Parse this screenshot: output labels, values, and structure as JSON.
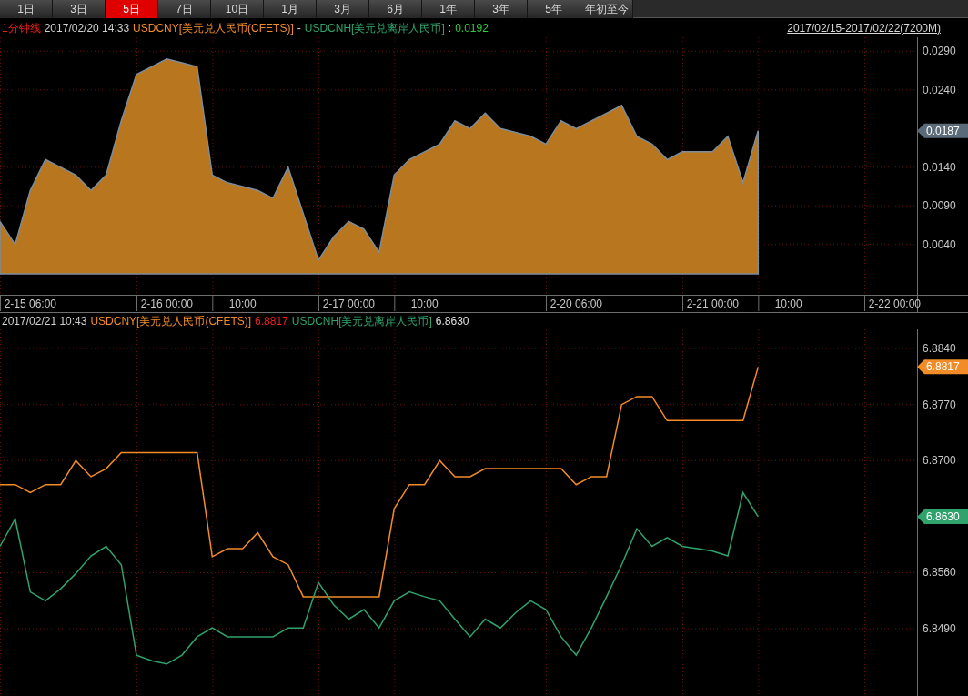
{
  "tabs": [
    {
      "label": "1日",
      "selected": false
    },
    {
      "label": "3日",
      "selected": false
    },
    {
      "label": "5日",
      "selected": true
    },
    {
      "label": "7日",
      "selected": false
    },
    {
      "label": "10日",
      "selected": false
    },
    {
      "label": "1月",
      "selected": false
    },
    {
      "label": "3月",
      "selected": false
    },
    {
      "label": "6月",
      "selected": false
    },
    {
      "label": "1年",
      "selected": false
    },
    {
      "label": "3年",
      "selected": false
    },
    {
      "label": "5年",
      "selected": false
    },
    {
      "label": "年初至今",
      "selected": false
    }
  ],
  "spread_panel": {
    "period": "1分钟线",
    "time": "2017/02/20 14:33",
    "series_a": "USDCNY[美元兑人民币(CFETS)]",
    "separator": "-",
    "series_b": "USDCNH[美元兑离岸人民币]",
    "colon": ":",
    "value": "0.0192",
    "range_link": "2017/02/15-2017/02/22(7200M)",
    "chart_data": {
      "type": "area",
      "ylim": [
        -0.0025,
        0.0308
      ],
      "grid": true,
      "categories": [
        null,
        null,
        "2-15 06:00",
        null,
        null,
        null,
        null,
        null,
        null,
        null,
        null,
        "2-16 00:00",
        null,
        null,
        null,
        null,
        "10:00",
        null,
        null,
        null,
        null,
        null,
        null,
        "2-17 00:00",
        null,
        null,
        null,
        null,
        "10:00",
        null,
        null,
        null,
        null,
        null,
        null,
        null,
        null,
        null,
        "2-20 06:00",
        null,
        null,
        null,
        null,
        null,
        null,
        null,
        null,
        "2-21 00:00",
        null,
        null,
        null,
        null,
        "10:00",
        null,
        null,
        null,
        null,
        null,
        null,
        "2-22 00:00",
        null
      ],
      "series": [
        {
          "color": "#b8761f",
          "values": [
            0.007,
            0.004,
            0.011,
            0.015,
            0.014,
            0.013,
            0.011,
            0.013,
            0.02,
            0.026,
            0.027,
            0.028,
            0.0275,
            0.027,
            0.013,
            0.012,
            0.0115,
            0.011,
            0.01,
            0.014,
            0.008,
            0.002,
            0.005,
            0.007,
            0.006,
            0.003,
            0.013,
            0.015,
            0.016,
            0.017,
            0.02,
            0.019,
            0.021,
            0.019,
            0.0185,
            0.018,
            0.017,
            0.02,
            0.019,
            0.02,
            0.021,
            0.022,
            0.018,
            0.017,
            0.015,
            0.016,
            0.016,
            0.016,
            0.018,
            0.012,
            0.0187,
            null,
            null,
            null,
            null,
            null,
            null,
            null,
            null,
            null,
            null
          ]
        }
      ],
      "yticks": [
        {
          "value": 0.029,
          "label": "0.0290"
        },
        {
          "value": 0.024,
          "label": "0.0240"
        },
        {
          "value": 0.014,
          "label": "0.0140"
        },
        {
          "value": 0.009,
          "label": "0.0090"
        },
        {
          "value": 0.004,
          "label": "0.0040"
        }
      ],
      "annotations": [
        "0.0187"
      ]
    }
  },
  "price_panel": {
    "time": "2017/02/21 10:43",
    "value_a": "6.8817",
    "value_b": "6.8630",
    "chart_data": {
      "type": "line",
      "grid": true,
      "ylim": [
        6.8406,
        6.8864
      ],
      "series": [
        {
          "name": "USDCNY[美元兑人民币(CFETS)]",
          "color": "#f28c28",
          "values": [
            6.867,
            6.867,
            6.866,
            6.867,
            6.867,
            6.87,
            6.868,
            6.869,
            6.871,
            6.871,
            6.871,
            6.871,
            6.871,
            6.871,
            6.858,
            6.859,
            6.859,
            6.861,
            6.858,
            6.857,
            6.853,
            6.853,
            6.853,
            6.853,
            6.853,
            6.853,
            6.864,
            6.867,
            6.867,
            6.87,
            6.868,
            6.868,
            6.869,
            6.869,
            6.869,
            6.869,
            6.869,
            6.869,
            6.867,
            6.868,
            6.868,
            6.877,
            6.878,
            6.878,
            6.875,
            6.875,
            6.875,
            6.875,
            6.875,
            6.875,
            6.8817
          ]
        },
        {
          "name": "USDCNH[美元兑离岸人民币]",
          "color": "#2fa36b",
          "values": [
            6.8593,
            6.8627,
            6.8536,
            6.8525,
            6.854,
            6.8559,
            6.8581,
            6.8593,
            6.857,
            6.8457,
            6.845,
            6.8446,
            6.8457,
            6.848,
            6.8491,
            6.848,
            6.848,
            6.848,
            6.848,
            6.8491,
            6.8491,
            6.8548,
            6.852,
            6.8502,
            6.8514,
            6.8491,
            6.8525,
            6.8536,
            6.853,
            6.8525,
            6.8502,
            6.848,
            6.8502,
            6.8491,
            6.851,
            6.8525,
            6.8514,
            6.848,
            6.8457,
            6.8491,
            6.853,
            6.857,
            6.8615,
            6.8593,
            6.8604,
            6.8593,
            6.859,
            6.8587,
            6.8581,
            6.866,
            6.863
          ]
        }
      ],
      "yticks": [
        {
          "value": 6.884,
          "label": "6.8840"
        },
        {
          "value": 6.877,
          "label": "6.8770"
        },
        {
          "value": 6.87,
          "label": "6.8700"
        },
        {
          "value": 6.856,
          "label": "6.8560"
        },
        {
          "value": 6.849,
          "label": "6.8490"
        }
      ],
      "annotations": [
        "6.8817",
        "6.8630"
      ]
    }
  }
}
